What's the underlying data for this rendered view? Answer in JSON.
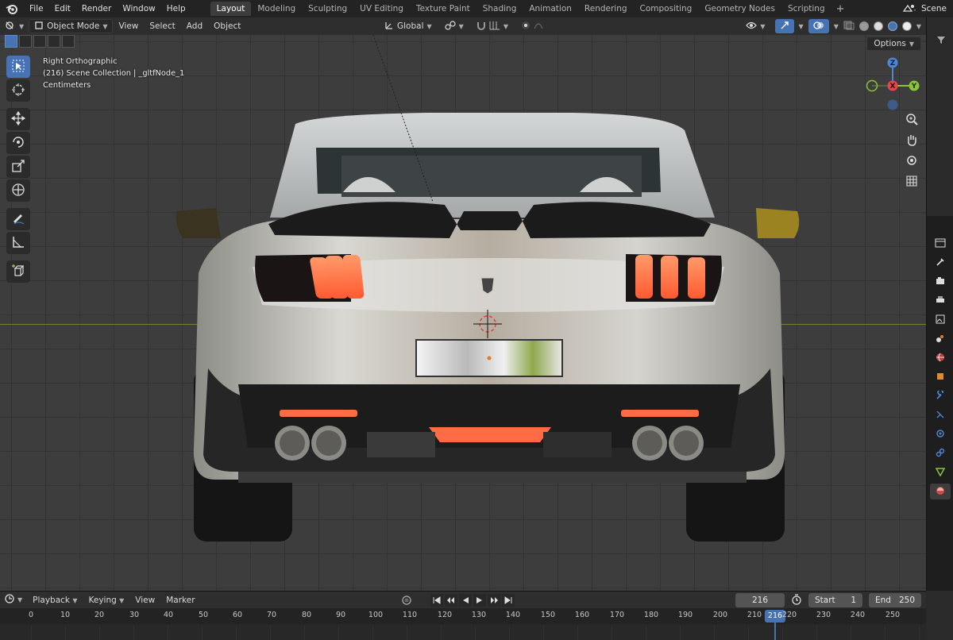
{
  "menu": {
    "items": [
      "File",
      "Edit",
      "Render",
      "Window",
      "Help"
    ],
    "workspaces": [
      "Layout",
      "Modeling",
      "Sculpting",
      "UV Editing",
      "Texture Paint",
      "Shading",
      "Animation",
      "Rendering",
      "Compositing",
      "Geometry Nodes",
      "Scripting"
    ],
    "active_workspace": "Layout",
    "add_tab": "+",
    "scene_label": "Scene"
  },
  "viewport_header": {
    "mode": "Object Mode",
    "menus": [
      "View",
      "Select",
      "Add",
      "Object"
    ],
    "transform_orientation": "Global",
    "options_label": "Options"
  },
  "overlay": {
    "view_name": "Right Orthographic",
    "collection_info": "(216) Scene Collection | _gltfNode_1",
    "units": "Centimeters"
  },
  "gizmo": {
    "z": "Z",
    "x": "X",
    "y": "Y"
  },
  "tools": [
    "select-box",
    "cursor",
    "move",
    "rotate",
    "scale",
    "transform",
    "annotate",
    "measure",
    "add-cube"
  ],
  "timeline": {
    "menus": [
      "Playback",
      "Keying",
      "View",
      "Marker"
    ],
    "current_frame": "216",
    "start_label": "Start",
    "start_value": "1",
    "end_label": "End",
    "end_value": "250",
    "ruler_ticks": [
      "0",
      "10",
      "20",
      "30",
      "40",
      "50",
      "60",
      "70",
      "80",
      "90",
      "100",
      "110",
      "120",
      "130",
      "140",
      "150",
      "160",
      "170",
      "180",
      "190",
      "200",
      "210",
      "216",
      "220",
      "230",
      "240",
      "250"
    ]
  },
  "colors": {
    "accent": "#4772b3",
    "gizmo_x": "#e8444e",
    "gizmo_y": "#8bc43a",
    "gizmo_z": "#4d86d8",
    "taillight": "#ff6b45"
  }
}
